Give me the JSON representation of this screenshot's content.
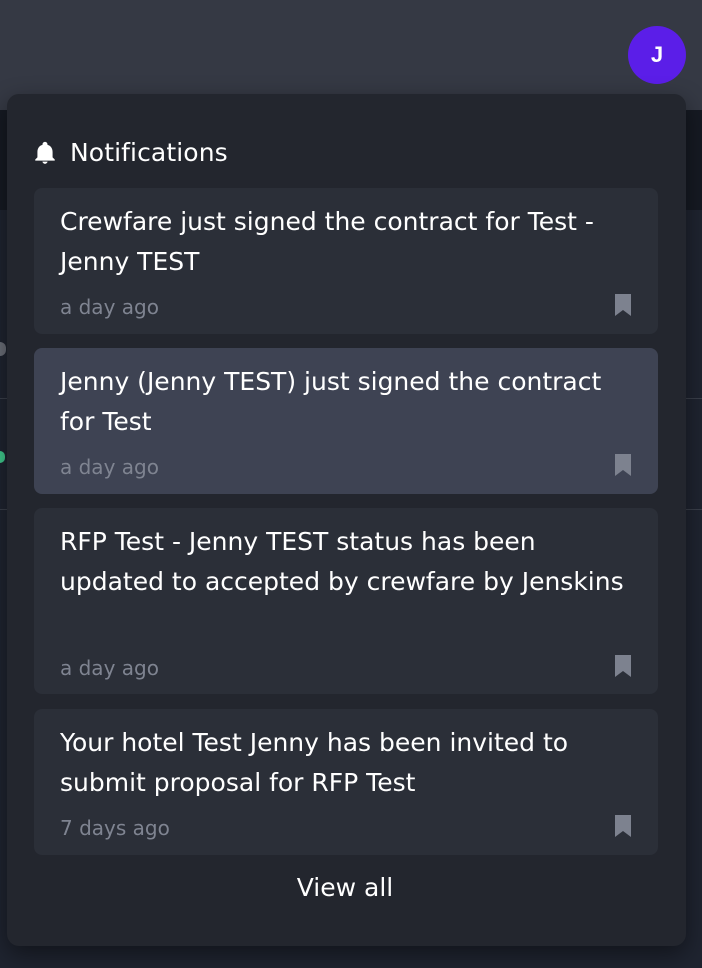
{
  "app": {
    "user_initial": "J",
    "accent_color": "#5b1ee8"
  },
  "notifications_panel": {
    "title": "Notifications",
    "header_icon": "bell-icon",
    "items": [
      {
        "text": "Crewfare just signed the contract for Test - Jenny TEST",
        "time": "a day ago",
        "bookmark_icon": "bookmark-icon"
      },
      {
        "text": "Jenny (Jenny TEST) just signed the contract for Test",
        "time": "a day ago",
        "bookmark_icon": "bookmark-icon"
      },
      {
        "text": "RFP Test - Jenny TEST status has been updated to accepted by crewfare by Jenskins",
        "time": "a day ago",
        "bookmark_icon": "bookmark-icon"
      },
      {
        "text": "Your hotel Test Jenny has been invited to submit proposal for RFP Test",
        "time": "7 days ago",
        "bookmark_icon": "bookmark-icon"
      }
    ],
    "view_all_label": "View all"
  }
}
